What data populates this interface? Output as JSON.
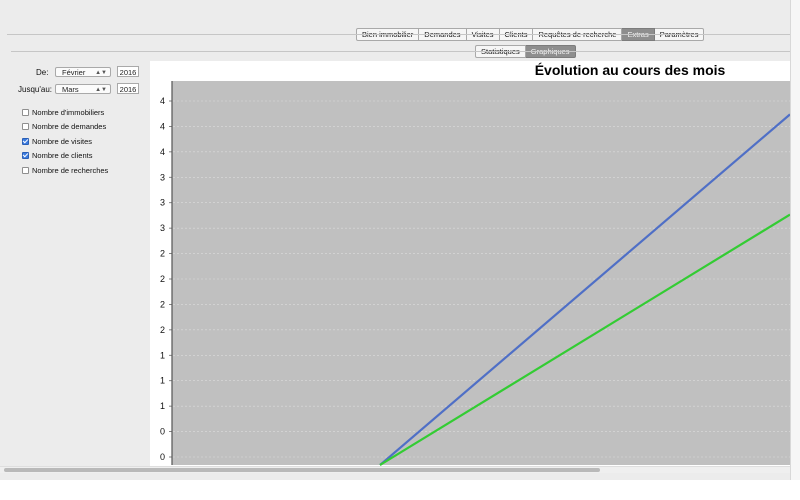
{
  "tabs": [
    "Bien immobilier",
    "Demandes",
    "Visites",
    "Clients",
    "Requêtes de recherche",
    "Extras",
    "Paramètres"
  ],
  "active_tab": "Extras",
  "subtabs": [
    "Statistiques",
    "Graphiques"
  ],
  "active_subtab": "Graphiques",
  "filters": {
    "from_label": "De:",
    "from_month": "Février",
    "from_year": "2016",
    "to_label": "Jusqu'au:",
    "to_month": "Mars",
    "to_year": "2016"
  },
  "checkboxes": [
    {
      "label": "Nombre d'immobiliers",
      "checked": false
    },
    {
      "label": "Nombre de demandes",
      "checked": false
    },
    {
      "label": "Nombre de visites",
      "checked": true
    },
    {
      "label": "Nombre de clients",
      "checked": true
    },
    {
      "label": "Nombre de recherches",
      "checked": false
    }
  ],
  "chart_data": {
    "type": "line",
    "title": "Évolution au cours des mois",
    "xlabel": "",
    "ylabel": "",
    "ylim": [
      0,
      4.6
    ],
    "y_tick_labels": [
      "0",
      "0",
      "1",
      "1",
      "1",
      "2",
      "2",
      "2",
      "2",
      "3",
      "3",
      "3",
      "4",
      "4",
      "4"
    ],
    "plot_background": "#c0c0c0",
    "grid": true,
    "x": [
      0,
      1
    ],
    "series": [
      {
        "color": "#4f6fc6",
        "values": [
          0,
          4.2
        ]
      },
      {
        "color": "#33cc33",
        "values": [
          0,
          3.0
        ]
      }
    ]
  }
}
